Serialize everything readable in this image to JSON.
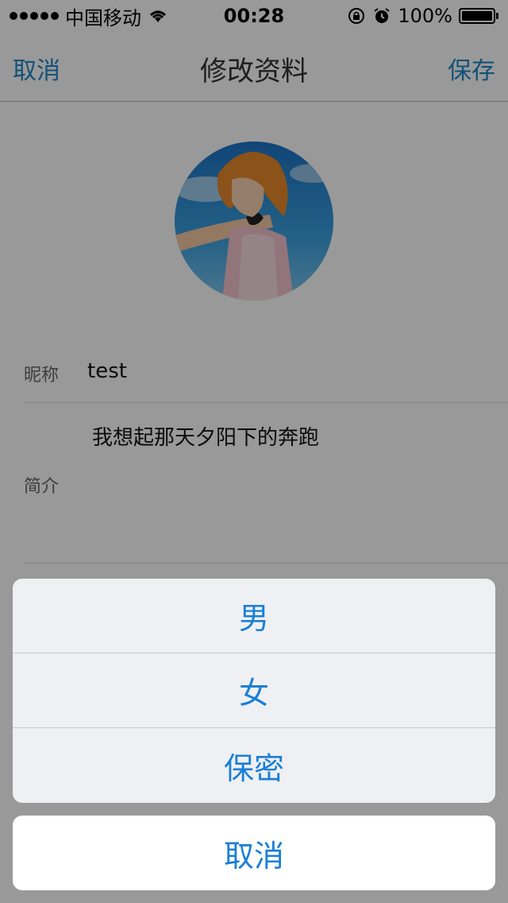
{
  "status_bar": {
    "carrier": "中国移动",
    "time": "00:28",
    "battery_percent": "100%",
    "battery_level": 1.0
  },
  "nav": {
    "cancel_label": "取消",
    "title": "修改资料",
    "save_label": "保存"
  },
  "profile": {
    "nickname_label": "昵称",
    "nickname_value": "test",
    "bio_label": "简介",
    "bio_value": "我想起那天夕阳下的奔跑"
  },
  "action_sheet": {
    "options": [
      {
        "label": "男"
      },
      {
        "label": "女"
      },
      {
        "label": "保密"
      }
    ],
    "cancel_label": "取消"
  },
  "colors": {
    "accent": "#1a7fd6",
    "nav_accent": "#1e88c8",
    "overlay": "rgba(0,0,0,0.40)"
  }
}
